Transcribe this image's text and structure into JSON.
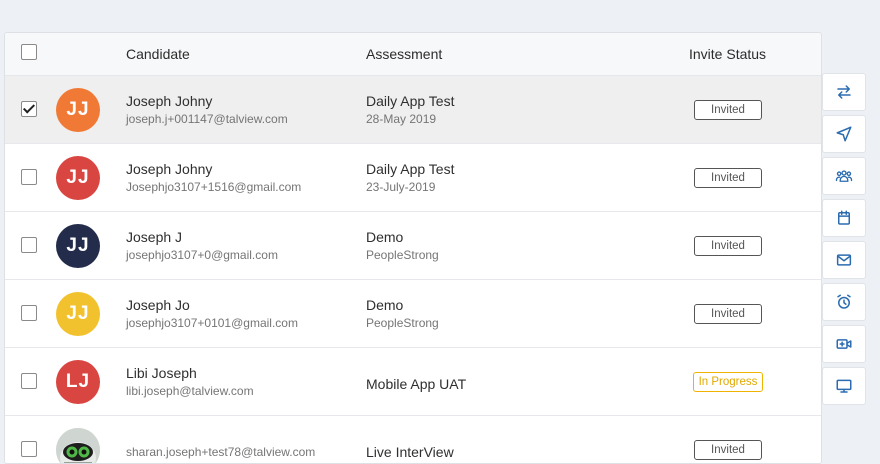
{
  "colors": {
    "accent": "#2b6cb0",
    "invited": "#555555",
    "in_progress": "#e0a800"
  },
  "table": {
    "columns": {
      "candidate": "Candidate",
      "assessment": "Assessment",
      "status": "Invite Status"
    },
    "rows": [
      {
        "initials": "JJ",
        "avatar_color": "#f07a35",
        "name": "Joseph Johny",
        "email": "joseph.j+001147@talview.com",
        "assessment": "Daily App Test",
        "sub": "28-May 2019",
        "status": "Invited",
        "checked": true
      },
      {
        "initials": "JJ",
        "avatar_color": "#d94540",
        "name": "Joseph Johny",
        "email": "Josephjo3107+1516@gmail.com",
        "assessment": "Daily App Test",
        "sub": "23-July-2019",
        "status": "Invited",
        "checked": false
      },
      {
        "initials": "JJ",
        "avatar_color": "#232c4a",
        "name": "Joseph J",
        "email": "josephjo3107+0@gmail.com",
        "assessment": "Demo",
        "sub": "PeopleStrong",
        "status": "Invited",
        "checked": false
      },
      {
        "initials": "JJ",
        "avatar_color": "#f2c12e",
        "name": "Joseph Jo",
        "email": "josephjo3107+0101@gmail.com",
        "assessment": "Demo",
        "sub": "PeopleStrong",
        "status": "Invited",
        "checked": false
      },
      {
        "initials": "LJ",
        "avatar_color": "#d94540",
        "name": "Libi Joseph",
        "email": "libi.joseph@talview.com",
        "assessment": "Mobile App UAT",
        "sub": "",
        "status": "In Progress",
        "checked": false
      },
      {
        "initials": "",
        "avatar_color": "",
        "name": "",
        "email": "sharan.joseph+test78@talview.com",
        "assessment": "Live InterView",
        "sub": "",
        "status": "Invited",
        "checked": false
      }
    ]
  },
  "sidebar": {
    "icons": [
      "swap-icon",
      "send-icon",
      "group-icon",
      "calendar-icon",
      "mail-icon",
      "alarm-clock-icon",
      "video-add-icon",
      "monitor-icon"
    ]
  }
}
